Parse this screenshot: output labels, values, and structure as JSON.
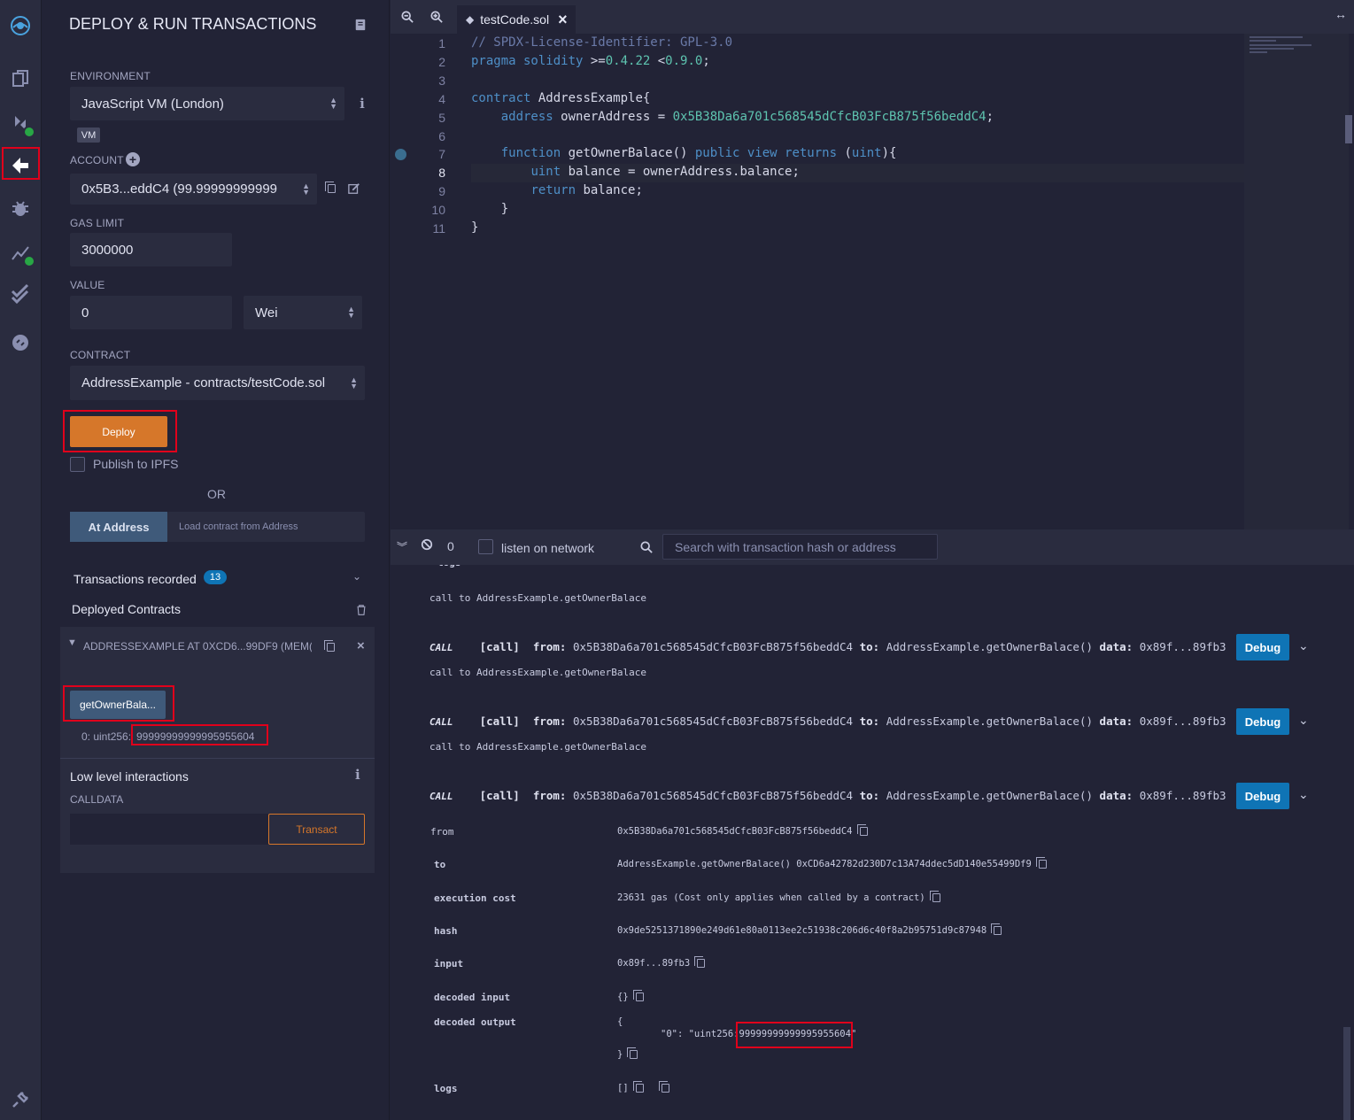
{
  "panel": {
    "title": "DEPLOY & RUN TRANSACTIONS",
    "environment_label": "ENVIRONMENT",
    "environment_value": "JavaScript VM (London)",
    "vm_badge": "VM",
    "account_label": "ACCOUNT",
    "account_value": "0x5B3...eddC4 (99.99999999999",
    "gas_limit_label": "GAS LIMIT",
    "gas_limit_value": "3000000",
    "value_label": "VALUE",
    "value_value": "0",
    "value_unit": "Wei",
    "contract_label": "CONTRACT",
    "contract_value": "AddressExample - contracts/testCode.sol",
    "deploy_label": "Deploy",
    "publish_label": "Publish to IPFS",
    "or_label": "OR",
    "at_address_label": "At Address",
    "at_address_placeholder": "Load contract from Address",
    "transactions_label": "Transactions recorded",
    "transactions_count": "13",
    "deployed_label": "Deployed Contracts",
    "instance_title": "ADDRESSEXAMPLE AT 0XCD6...99DF9 (MEM(",
    "function_label": "getOwnerBala...",
    "result_prefix": "0: uint256:",
    "result_value": "99999999999995955604",
    "low_level_label": "Low level interactions",
    "calldata_label": "CALLDATA",
    "transact_label": "Transact"
  },
  "editor": {
    "tab_name": "testCode.sol",
    "line_numbers": [
      "1",
      "2",
      "3",
      "4",
      "5",
      "6",
      "7",
      "8",
      "9",
      "10",
      "11"
    ]
  },
  "terminal": {
    "count": "0",
    "listen_label": "listen on network",
    "search_placeholder": "Search with transaction hash or address",
    "partial_top": "logs",
    "call_note": "call to AddressExample.getOwnerBalace",
    "call_tag": "CALL",
    "call_kind": "[call]",
    "from_key": "from:",
    "from_val": "0x5B38Da6a701c568545dCfcB03FcB875f56beddC4",
    "to_key": "to:",
    "to_val": "AddressExample.getOwnerBalace()",
    "data_key": "data:",
    "data_val": "0x89f...89fb3",
    "debug_label": "Debug",
    "details": {
      "from_label": "from",
      "from_value": "0x5B38Da6a701c568545dCfcB03FcB875f56beddC4",
      "to_label": "to",
      "to_value": "AddressExample.getOwnerBalace() 0xCD6a42782d230D7c13A74ddec5dD140e55499Df9",
      "cost_label": "execution cost",
      "cost_value": "23631 gas (Cost only applies when called by a contract)",
      "hash_label": "hash",
      "hash_value": "0x9de5251371890e249d61e80a0113ee2c51938c206d6c40f8a2b95751d9c87948",
      "input_label": "input",
      "input_value": "0x89f...89fb3",
      "decoded_input_label": "decoded input",
      "decoded_input_value": "{}",
      "decoded_output_label": "decoded output",
      "decoded_output_open": "{",
      "decoded_output_key": "\"0\": \"uint256:",
      "decoded_output_value": "99999999999995955604\"",
      "decoded_output_close": "}",
      "logs_label": "logs",
      "logs_value": "[]"
    }
  }
}
